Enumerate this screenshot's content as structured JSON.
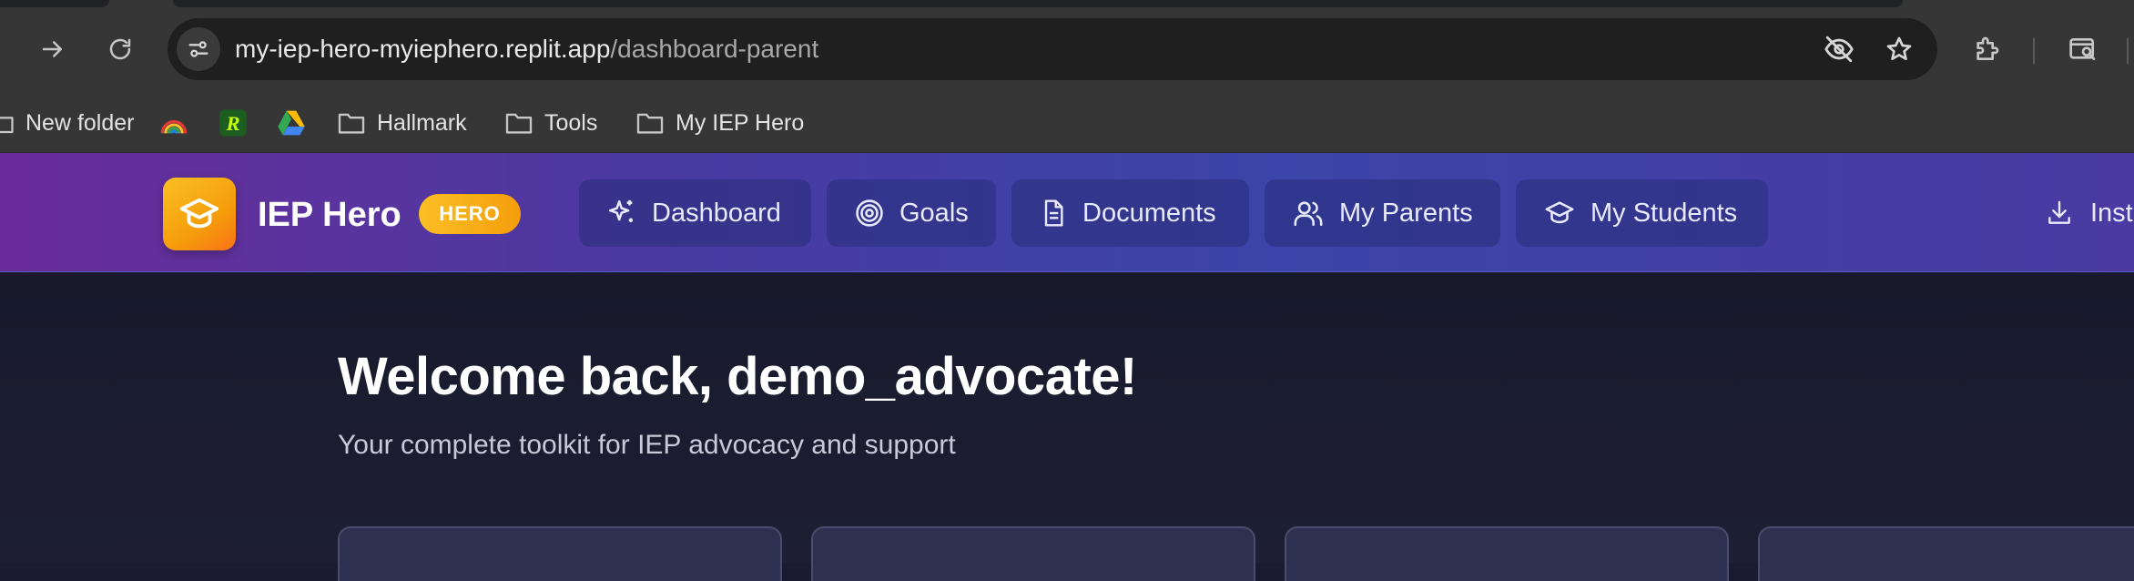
{
  "browser": {
    "url_host": "my-iep-hero-myiephero.replit.app",
    "url_path": "/dashboard-parent",
    "toolbar_icons": [
      "forward-icon",
      "reload-icon",
      "site-info-icon",
      "eye-off-icon",
      "star-icon",
      "extensions-icon",
      "tab-search-icon"
    ],
    "bookmarks": [
      {
        "label": "New folder",
        "icon": "folder-icon"
      },
      {
        "label": "",
        "icon": "rainbow-icon"
      },
      {
        "label": "",
        "icon": "r-logo-icon"
      },
      {
        "label": "",
        "icon": "google-drive-icon"
      },
      {
        "label": "Hallmark",
        "icon": "folder-icon"
      },
      {
        "label": "Tools",
        "icon": "folder-icon"
      },
      {
        "label": "My IEP Hero",
        "icon": "folder-icon"
      }
    ]
  },
  "header": {
    "brand_name": "IEP Hero",
    "badge": "HERO",
    "nav": [
      {
        "label": "Dashboard",
        "icon": "sparkles-icon"
      },
      {
        "label": "Goals",
        "icon": "target-icon"
      },
      {
        "label": "Documents",
        "icon": "document-icon"
      },
      {
        "label": "My Parents",
        "icon": "users-icon"
      },
      {
        "label": "My Students",
        "icon": "graduation-cap-icon"
      }
    ],
    "install_label": "Inst"
  },
  "main": {
    "welcome": "Welcome back, demo_advocate!",
    "subtitle": "Your complete toolkit for IEP advocacy and support"
  },
  "colors": {
    "header_gradient_start": "#6a2c9a",
    "header_gradient_end": "#3b44a8",
    "badge": "#fbbf24",
    "page_background": "#1a1b2e"
  }
}
